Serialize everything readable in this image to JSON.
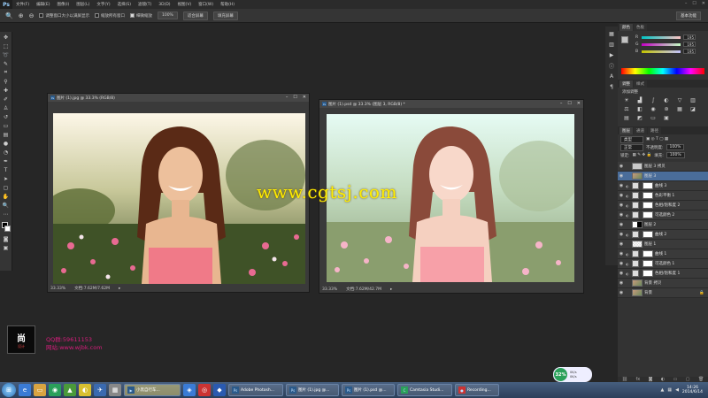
{
  "app": {
    "logo": "Ps"
  },
  "menu": [
    "文件(F)",
    "编辑(E)",
    "图像(I)",
    "图层(L)",
    "文字(Y)",
    "选择(S)",
    "滤镜(T)",
    "3D(D)",
    "视图(V)",
    "窗口(W)",
    "帮助(H)"
  ],
  "window_controls": [
    "–",
    "☐",
    "✕"
  ],
  "options_bar": {
    "checks": [
      {
        "label": "调整窗口大小以满屏显示",
        "checked": false
      },
      {
        "label": "缩放所有窗口",
        "checked": false
      },
      {
        "label": "细微缩放",
        "checked": true
      }
    ],
    "buttons": [
      "100%",
      "适合屏幕",
      "填充屏幕"
    ],
    "workspace": "基本功能"
  },
  "documents": [
    {
      "title": "图片 (1).jpg @ 33.3% (RGB/8)",
      "zoom": "33.33%",
      "doc_size": "文档:7.62M/7.62M",
      "controls": [
        "–",
        "☐",
        "✕"
      ]
    },
    {
      "title": "图片 (1).psd @ 33.3% (图层 3, RGB/8) *",
      "zoom": "33.33%",
      "doc_size": "文档:7.62M/42.7M",
      "controls": [
        "–",
        "☐",
        "✕"
      ]
    }
  ],
  "watermark": "www.cgtsj.com",
  "color_panel": {
    "tabs": [
      "颜色",
      "色板"
    ],
    "channels": [
      {
        "name": "R",
        "value": "195"
      },
      {
        "name": "G",
        "value": "195"
      },
      {
        "name": "B",
        "value": "195"
      }
    ]
  },
  "adjustments_panel": {
    "tabs": [
      "调整",
      "样式"
    ],
    "label": "添加调整"
  },
  "layers_panel": {
    "tabs": [
      "图层",
      "通道",
      "路径"
    ],
    "kind": "类型",
    "blend": "正常",
    "opacity_label": "不透明度:",
    "opacity": "100%",
    "lock_label": "锁定:",
    "fill_label": "填充:",
    "fill": "100%",
    "layers": [
      {
        "name": "图层 3 拷贝",
        "thumb": "pink",
        "selected": false,
        "adj": false
      },
      {
        "name": "图层 3",
        "thumb": "img",
        "selected": true,
        "adj": false
      },
      {
        "name": "曲线 3",
        "thumb": "adj",
        "selected": false,
        "adj": true
      },
      {
        "name": "色彩平衡 1",
        "thumb": "adj",
        "selected": false,
        "adj": true
      },
      {
        "name": "色相/饱和度 2",
        "thumb": "adj",
        "selected": false,
        "adj": true
      },
      {
        "name": "可选颜色 2",
        "thumb": "adj",
        "selected": false,
        "adj": true
      },
      {
        "name": "图层 2",
        "thumb": "mask",
        "selected": false,
        "adj": false
      },
      {
        "name": "曲线 2",
        "thumb": "adj",
        "selected": false,
        "adj": true
      },
      {
        "name": "图层 1",
        "thumb": "check",
        "selected": false,
        "adj": false
      },
      {
        "name": "曲线 1",
        "thumb": "adj",
        "selected": false,
        "adj": true
      },
      {
        "name": "可选颜色 1",
        "thumb": "adj",
        "selected": false,
        "adj": true
      },
      {
        "name": "色相/饱和度 1",
        "thumb": "adj",
        "selected": false,
        "adj": true
      },
      {
        "name": "背景 拷贝",
        "thumb": "img",
        "selected": false,
        "adj": false
      },
      {
        "name": "背景",
        "thumb": "img",
        "selected": false,
        "adj": false
      }
    ]
  },
  "branding": {
    "main": "尚",
    "sub": "设计",
    "qq": "QQ群:59611153",
    "site": "网站:www.wjbk.com"
  },
  "speed_widget": {
    "percent": "32%",
    "up": "0K/s",
    "down": "0K/s"
  },
  "taskbar": {
    "tasks": [
      {
        "label": "小黑自行车...",
        "active": true
      },
      {
        "label": "Adobe Photosh...",
        "active": false
      },
      {
        "label": "图片 (1).jpg @...",
        "active": false
      },
      {
        "label": "图片 (1).psd @...",
        "active": false
      },
      {
        "label": "Camtasia Studi...",
        "active": false
      },
      {
        "label": "Recording...",
        "active": false
      }
    ],
    "time": "14:26",
    "date": "2014/6/14"
  }
}
